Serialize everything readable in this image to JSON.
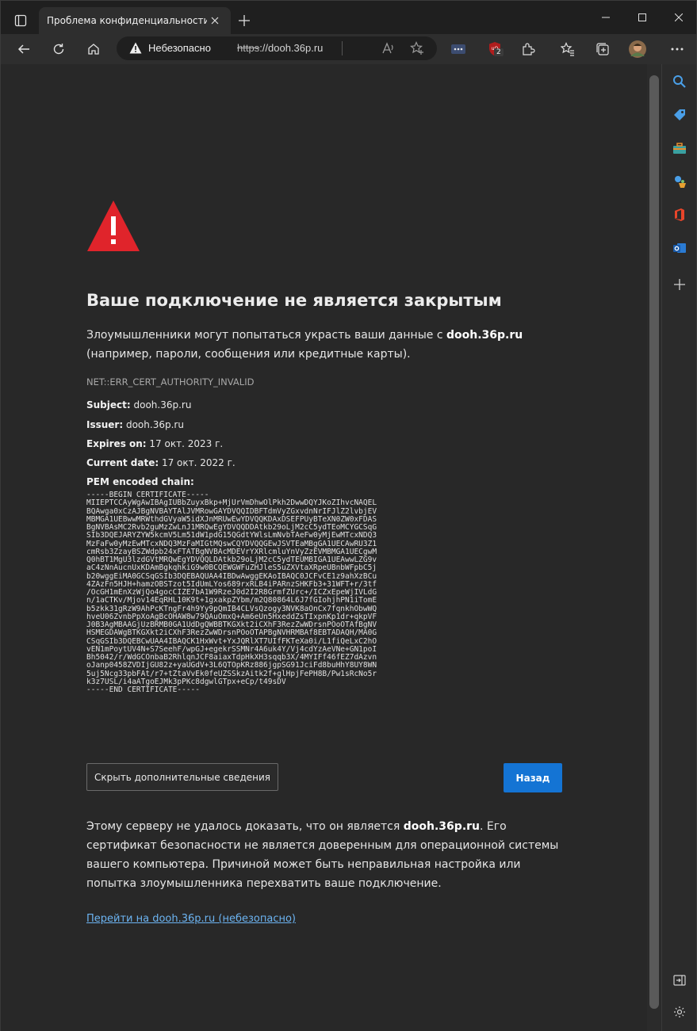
{
  "tab": {
    "title": "Проблема конфиденциальности"
  },
  "address": {
    "security_label": "Небезопасно",
    "url_scheme": "https",
    "url_rest": "://dooh.36p.ru"
  },
  "extensions": {
    "ublock_badge": "2"
  },
  "page": {
    "title": "Ваше подключение не является закрытым",
    "desc_before": "Злоумышленники могут попытаться украсть ваши данные с ",
    "desc_host": "dooh.36p.ru",
    "desc_after": " (например, пароли, сообщения или кредитные карты).",
    "error_code": "NET::ERR_CERT_AUTHORITY_INVALID",
    "subject_label": "Subject:",
    "subject_value": " dooh.36p.ru",
    "issuer_label": "Issuer:",
    "issuer_value": " dooh.36p.ru",
    "expires_label": "Expires on:",
    "expires_value": " 17 окт. 2023 г.",
    "current_label": "Current date:",
    "current_value": " 17 окт. 2022 г.",
    "pem_label": "PEM encoded chain:",
    "pem": "-----BEGIN CERTIFICATE-----\nMIIEPTCCAyWgAwIBAgIUBbZuyxBkp+MjUrVmDhwOlPkh2DwwDQYJKoZIhvcNAQEL\nBQAwga0xCzAJBgNVBAYTAlJVMRowGAYDVQQIDBFTdmVyZGxvdnNrIFJlZ2lvbjEV\nMBMGA1UEBwwMRWthdGVyaW5idXJnMRUwEwYDVQQKDAxDSEFPUyBTeXN0ZW0xFDAS\nBgNVBAsMC2Rvb2guMzZwLnJ1MRQwEgYDVQQDDAtkb29oLjM2cC5ydTEoMCYGCSqG\nSIb3DQEJARYZYW5kcmV5Lm51dW1pdG15QGdtYWlsLmNvbTAeFw0yMjEwMTcxNDQ3\nMzFaFw0yMzEwMTcxNDQ3MzFaMIGtMQswCQYDVQQGEwJSVTEaMBgGA1UECAwRU3Z1\ncmRsb3ZzayBSZWdpb24xFTATBgNVBAcMDEVrYXRlcmluYnVyZzEVMBMGA1UECgwM\nQ0hBT1MgU3lzdGVtMRQwEgYDVQQLDAtkb29oLjM2cC5ydTEUMBIGA1UEAwwLZG9v\naC4zNnAucnUxKDAmBgkqhkiG9w0BCQEWGWFuZHJleS5uZXVtaXRpeUBnbWFpbC5j\nb20wggEiMA0GCSqGSIb3DQEBAQUAA4IBDwAwggEKAoIBAQC0JCFvCE1z9ahXzBCu\n4ZAzFn5HJH+hamzOBSTzot5IdUmLYos689rxRLB4iPARnzSHKFb3+31WFT+r/3tf\n/OcGH1mEnXzWjQo4gocCIZE7bA1W9RzeJ0d2I2R8GrmfZUrc+/ICZxEpeWjIVLdG\nn/1aCTKv/Mjov14EqRHL10K9t+1gxakpZYbm/m2Q80864L6J7fGIohjhPN1iTomE\nb5zkk31gRzW9AhPcKTngFr4h9Yy9pQmIB4CLVsQzogy3NVK8aOnCx7fqnkhObwWQ\nhveU06ZvnbPpXoAgBcOHAW8w79QAuOmxQ+Am6eUn5HxeddZsTIxpnKp1dr+qkpVF\nJ0B3AgMBAAGjUzBRMB0GA1UdDgQWBBTKGXkt2iCXhF3RezZwWDrsnPOoOTAfBgNV\nHSMEGDAWgBTKGXkt2iCXhF3RezZwWDrsnPOoOTAPBgNVHRMBAf8EBTADAQH/MA0G\nCSqGSIb3DQEBCwUAA4IBAQCK1HxWvt+YxJQRlXT7UIfFKTeXa0i/L1fiQeLxC2hO\nvEN1mPoytUV4N+S7SeehF/wpGJ+egekrSSMNr4A6uk4Y/Vj4cdYzAeVNe+GN1poI\nBh5042/r/WdGCOnbaB2RhlqnJCF8aiaxTdpHkXH3sqqb3X/4MYIFf46fEZ7dAzvn\noJanp0458ZVDIjGU82z+yaUGdV+3L6QTOpKRz886jgpSG91JciFd8buHhY8UY8WN\n5uj5Ncg33pbFAt/r7+tZtaVvEk0feUZSSkzAitk2f+glHpjFePH8B/Pw1sRcNo5r\nk3z7USL/i4aATgoEJMk3pPKc8dgwlGTpx+eCp/t49sDV\n-----END CERTIFICATE-----",
    "hide_button": "Скрыть дополнительные сведения",
    "back_button": "Назад",
    "explain_before": "Этому серверу не удалось доказать, что он является ",
    "explain_host": "dooh.36p.ru",
    "explain_after": ". Его сертификат безопасности не является доверенным для операционной системы вашего компьютера. Причиной может быть неправильная настройка или попытка злоумышленника перехватить ваше подключение.",
    "proceed_link": "Перейти на dooh.36p.ru (небезопасно)"
  },
  "colors": {
    "warning_red": "#e0242b",
    "accent_blue": "#1474d4",
    "link": "#6cb4f2"
  }
}
